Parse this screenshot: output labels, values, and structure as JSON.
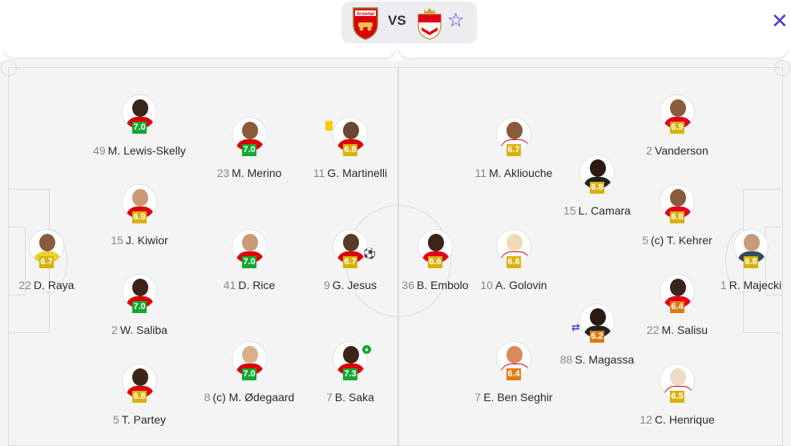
{
  "header": {
    "vs_label": "VS",
    "home_crest_icon": "arsenal-crest-icon",
    "away_crest_icon": "monaco-crest-icon",
    "favorite_icon": "star-icon",
    "close_icon": "close-icon",
    "close_glyph": "✕",
    "star_glyph": "☆"
  },
  "colors": {
    "accent": "#4a3fd8",
    "rating_green": "#12a832",
    "rating_yellow": "#d9b10a",
    "rating_orange": "#e07b10",
    "arsenal_red": "#db0007",
    "monaco_red": "#e2001a"
  },
  "home_players": [
    {
      "num": "49",
      "name": "M. Lewis-Skelly",
      "rating": "7.0",
      "band": "green"
    },
    {
      "num": "23",
      "name": "M. Merino",
      "rating": "7.0",
      "band": "green"
    },
    {
      "num": "11",
      "name": "G. Martinelli",
      "rating": "6.8",
      "band": "yellow"
    },
    {
      "num": "15",
      "name": "J. Kiwior",
      "rating": "6.9",
      "band": "yellow"
    },
    {
      "num": "22",
      "name": "D. Raya",
      "rating": "6.7",
      "band": "yellow"
    },
    {
      "num": "41",
      "name": "D. Rice",
      "rating": "7.0",
      "band": "green"
    },
    {
      "num": "9",
      "name": "G. Jesus",
      "rating": "6.7",
      "band": "yellow"
    },
    {
      "num": "2",
      "name": "W. Saliba",
      "rating": "7.0",
      "band": "green"
    },
    {
      "num": "8",
      "name": "(c) M. Ødegaard",
      "rating": "7.0",
      "band": "green"
    },
    {
      "num": "7",
      "name": "B. Saka",
      "rating": "7.3",
      "band": "green"
    },
    {
      "num": "5",
      "name": "T. Partey",
      "rating": "6.8",
      "band": "yellow"
    }
  ],
  "away_players": [
    {
      "num": "11",
      "name": "M. Akliouche",
      "rating": "6.7",
      "band": "yellow"
    },
    {
      "num": "2",
      "name": "Vanderson",
      "rating": "6.9",
      "band": "yellow"
    },
    {
      "num": "15",
      "name": "L. Camara",
      "rating": "6.8",
      "band": "yellow"
    },
    {
      "num": "5",
      "name": "(c) T. Kehrer",
      "rating": "6.8",
      "band": "yellow"
    },
    {
      "num": "36",
      "name": "B. Embolo",
      "rating": "6.6",
      "band": "yellow"
    },
    {
      "num": "10",
      "name": "A. Golovin",
      "rating": "6.6",
      "band": "yellow"
    },
    {
      "num": "1",
      "name": "R. Majecki",
      "rating": "6.8",
      "band": "yellow"
    },
    {
      "num": "22",
      "name": "M. Salisu",
      "rating": "6.4",
      "band": "orange"
    },
    {
      "num": "88",
      "name": "S. Magassa",
      "rating": "6.2",
      "band": "orange"
    },
    {
      "num": "7",
      "name": "E. Ben Seghir",
      "rating": "6.4",
      "band": "orange"
    },
    {
      "num": "12",
      "name": "C. Henrique",
      "rating": "6.5",
      "band": "yellow"
    }
  ],
  "events": {
    "yellow_card_icon": "yellow-card-icon",
    "goal_icon": "goal-icon",
    "substitution_icon": "substitution-icon",
    "ball_icon": "ball-icon"
  }
}
